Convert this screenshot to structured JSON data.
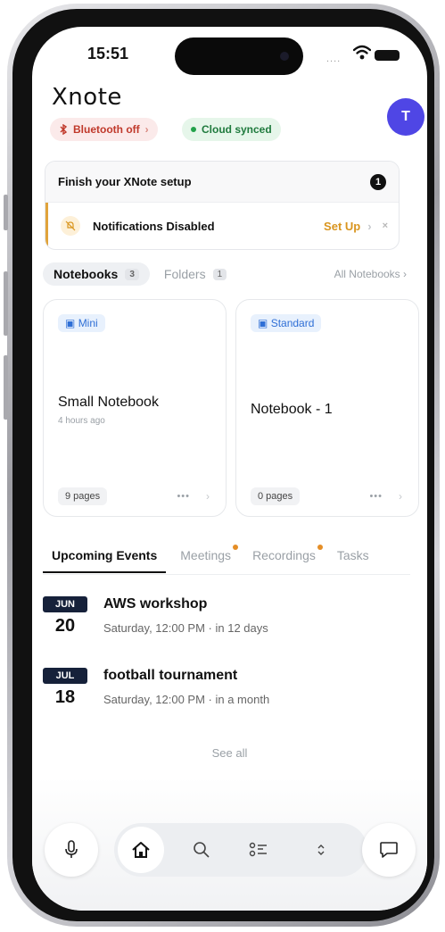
{
  "status_bar": {
    "time": "15:51",
    "signal": "....",
    "icons": [
      "wifi-icon",
      "battery-icon"
    ]
  },
  "header": {
    "logo": "Xnote",
    "avatar_initial": "T"
  },
  "chips": {
    "bluetooth": "Bluetooth off",
    "bluetooth_chevron": "›",
    "cloud": "Cloud synced"
  },
  "setup": {
    "title": "Finish your XNote setup",
    "count": "1",
    "row_label": "Notifications Disabled",
    "action": "Set Up",
    "action_chevron": "›",
    "dismiss": "×"
  },
  "notebook_tabs": {
    "notebooks": "Notebooks",
    "notebooks_count": "3",
    "folders": "Folders",
    "folders_count": "1",
    "all": "All Notebooks ›"
  },
  "notebooks": [
    {
      "tag": "Mini",
      "title": "Small Notebook",
      "subtitle": "4 hours ago",
      "pages": "9 pages",
      "more": "•••",
      "chevron": "›"
    },
    {
      "tag": "Standard",
      "title": "Notebook - 1",
      "subtitle": "",
      "pages": "0 pages",
      "more": "•••",
      "chevron": "›"
    }
  ],
  "event_tabs": [
    "Upcoming Events",
    "Meetings",
    "Recordings",
    "Tasks"
  ],
  "events": [
    {
      "month": "JUN",
      "day": "20",
      "title": "AWS workshop",
      "time": "Saturday, 12:00 PM · in 12 days"
    },
    {
      "month": "JUL",
      "day": "18",
      "title": "football tournament",
      "time": "Saturday, 12:00 PM · in a month"
    }
  ],
  "see_all": "See all",
  "bottom_nav": [
    "microphone-icon",
    "home-icon",
    "search-icon",
    "tasks-icon",
    "expand-icon",
    "chat-icon"
  ],
  "colors": {
    "avatar": "#4f46e5",
    "setup_accent": "#e0a33a",
    "tag_blue": "#2f6fd6",
    "bluetooth_red": "#c0392b",
    "cloud_green": "#1f7a3d"
  }
}
